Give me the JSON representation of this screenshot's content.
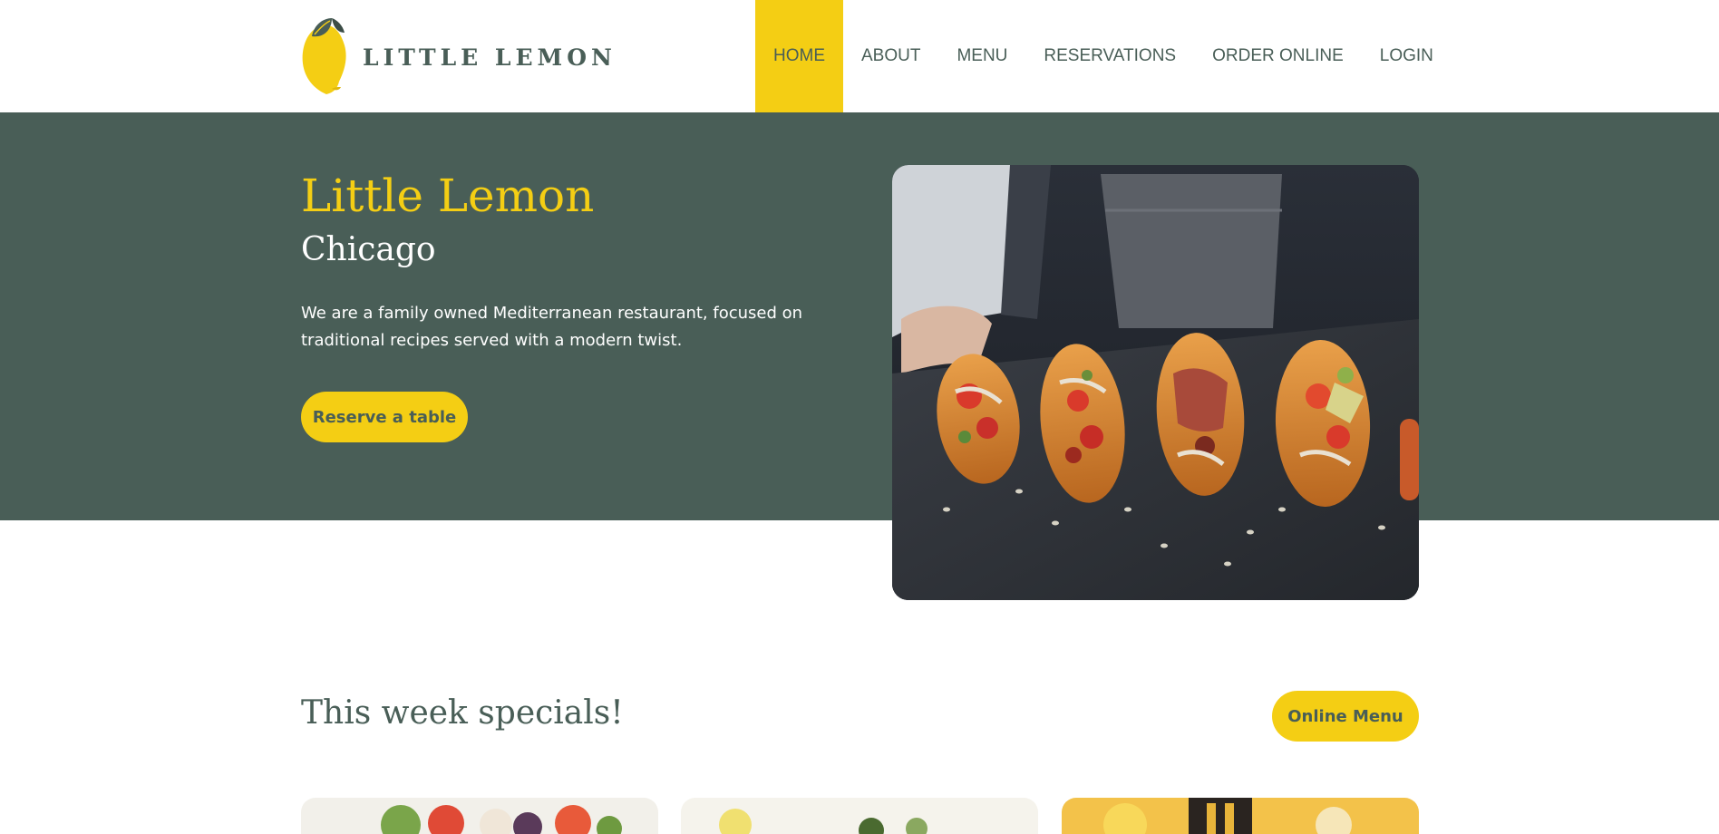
{
  "brand": {
    "name": "LITTLE LEMON"
  },
  "nav": {
    "items": [
      {
        "label": "HOME",
        "active": true
      },
      {
        "label": "ABOUT",
        "active": false
      },
      {
        "label": "MENU",
        "active": false
      },
      {
        "label": "RESERVATIONS",
        "active": false
      },
      {
        "label": "ORDER ONLINE",
        "active": false
      },
      {
        "label": "LOGIN",
        "active": false
      }
    ]
  },
  "hero": {
    "title": "Little Lemon",
    "subtitle": "Chicago",
    "description": "We are a family owned Mediterranean restaurant, focused on traditional recipes served with a modern twist.",
    "reserve_label": "Reserve a table"
  },
  "specials": {
    "title": "This week specials!",
    "online_menu_label": "Online Menu"
  },
  "colors": {
    "primary_green": "#495e57",
    "primary_yellow": "#f4ce14",
    "white": "#ffffff"
  },
  "icons": {
    "logo": "lemon-logo-icon"
  }
}
